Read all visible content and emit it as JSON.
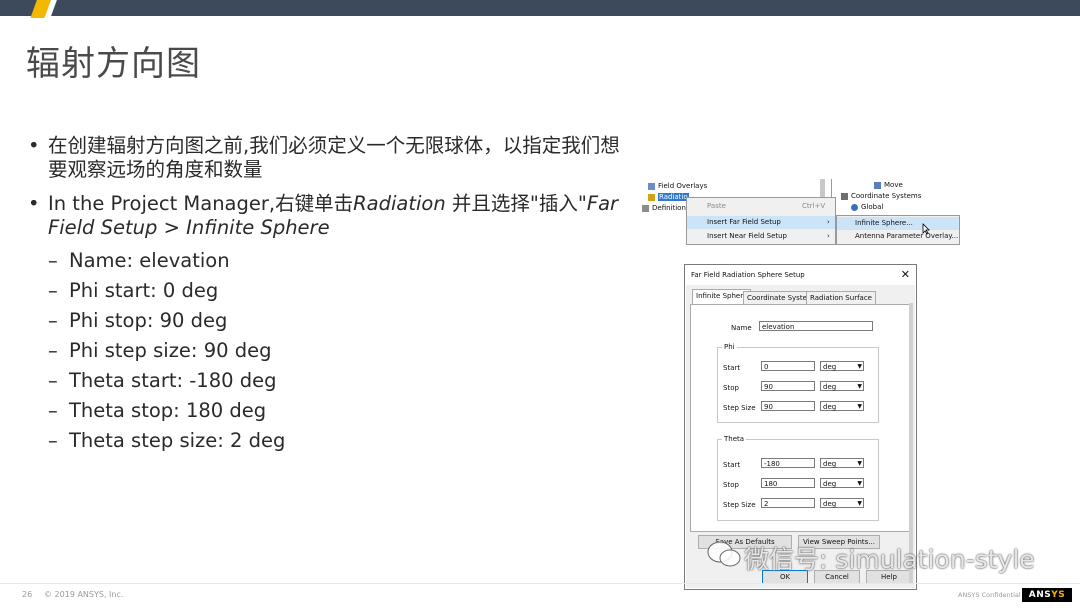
{
  "slide": {
    "title": "辐射方向图",
    "bullets": [
      {
        "text": "在创建辐射方向图之前,我们必须定义一个无限球体，以指定我们想要观察远场的角度和数量"
      },
      {
        "prefix": "In the Project Manager,右键单击",
        "italic1": "Radiation",
        "mid": " 并且选择\"插入\"",
        "italic2": "Far Field Setup > Infinite Sphere"
      }
    ],
    "sub_items": [
      "Name: elevation",
      "Phi start: 0 deg",
      "Phi stop: 90 deg",
      "Phi step size: 90 deg",
      "Theta start: -180 deg",
      "Theta stop: 180 deg",
      "Theta step size: 2 deg"
    ]
  },
  "context_menu": {
    "tree": [
      "Field Overlays",
      "Radiatio",
      "Definitions"
    ],
    "right_pane": [
      "Move",
      "Coordinate Systems",
      "Global"
    ],
    "menu1": [
      {
        "label": "Paste",
        "shortcut": "Ctrl+V"
      },
      {
        "label": "Insert Far Field Setup",
        "arrow": "›"
      },
      {
        "label": "Insert Near Field Setup",
        "arrow": "›"
      }
    ],
    "menu2": [
      "Infinite Sphere...",
      "Antenna Parameter Overlay..."
    ]
  },
  "dialog": {
    "title": "Far Field Radiation Sphere Setup",
    "close": "✕",
    "tabs": [
      "Infinite Sphere",
      "Coordinate System",
      "Radiation Surface"
    ],
    "name_label": "Name",
    "name_value": "elevation",
    "phi": {
      "group": "Phi",
      "rows": [
        {
          "label": "Start",
          "value": "0",
          "unit": "deg"
        },
        {
          "label": "Stop",
          "value": "90",
          "unit": "deg"
        },
        {
          "label": "Step Size",
          "value": "90",
          "unit": "deg"
        }
      ]
    },
    "theta": {
      "group": "Theta",
      "rows": [
        {
          "label": "Start",
          "value": "-180",
          "unit": "deg"
        },
        {
          "label": "Stop",
          "value": "180",
          "unit": "deg"
        },
        {
          "label": "Step Size",
          "value": "2",
          "unit": "deg"
        }
      ]
    },
    "buttons": {
      "save_defaults": "Save As Defaults",
      "view_sweep": "View Sweep Points...",
      "ok": "OK",
      "cancel": "Cancel",
      "help": "Help"
    }
  },
  "watermark": "微信号: simulation-style",
  "footer": {
    "page": "26",
    "copyright": "© 2019 ANSYS, Inc.",
    "confidential": "ANSYS Confidential",
    "logo_a": "ANS",
    "logo_b": "YS"
  },
  "colors": {
    "topbar": "#3d4a5c",
    "accent": "#f5b800",
    "menu_highlight": "#cce4f7"
  }
}
